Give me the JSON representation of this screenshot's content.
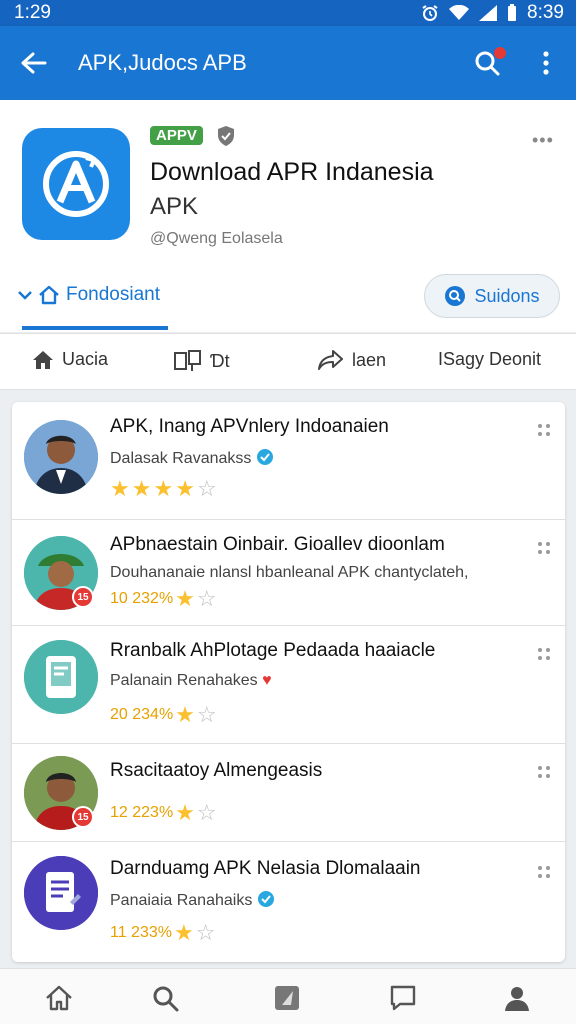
{
  "status": {
    "time_left": "1:29",
    "time_right": "8:39"
  },
  "appbar": {
    "title": "APK,Judocs APB"
  },
  "header": {
    "badge": "APPV",
    "title": "Download APR Indanesia",
    "subtitle": "APK",
    "developer": "@Qweng Eolasela",
    "more": "•••",
    "tab_label": "Fondosiant",
    "action_button": "Suidons"
  },
  "tabs": [
    {
      "label": "Uacia",
      "icon": "home-icon"
    },
    {
      "label": "Ɗt",
      "icon": "split-icon"
    },
    {
      "label": "laen",
      "icon": "share-icon"
    },
    {
      "label": "ISagy Deonit",
      "icon": ""
    }
  ],
  "list": [
    {
      "title": "APK, Inang APVnlery Indoanaien",
      "subtitle": "Dalasak Ravanakss",
      "rating_text": "",
      "stars": 4,
      "avatar": "person-1",
      "verified": true
    },
    {
      "title": "APbnaestain Oinbair. Gioallev dioonlam",
      "subtitle": "Douhananaie nlansl hbanleanal APK chantyclateh,",
      "rating_text": "10 232%",
      "stars": 1,
      "avatar": "person-2",
      "badge": "15"
    },
    {
      "title": "Rranbalk AhPlotage Pedaada haaiacle",
      "subtitle": "Palanain Renahakes",
      "rating_text": "20 234%",
      "stars": 1,
      "avatar": "tablet-app",
      "heart": true
    },
    {
      "title": "Rsacitaatoy Almengeasis",
      "subtitle": "",
      "rating_text": "12 223%",
      "stars": 1,
      "avatar": "person-3",
      "badge": "15"
    },
    {
      "title": "Darnduamg APK Nelasia Dlomalaain",
      "subtitle": "Panaiaia Ranahaiks",
      "rating_text": "11 233%",
      "stars": 1,
      "avatar": "doc-app",
      "verified": true
    }
  ],
  "colors": {
    "primary": "#1976d2",
    "status": "#1565c0",
    "green": "#43a047",
    "star": "#fbc02d",
    "red": "#e53935"
  }
}
